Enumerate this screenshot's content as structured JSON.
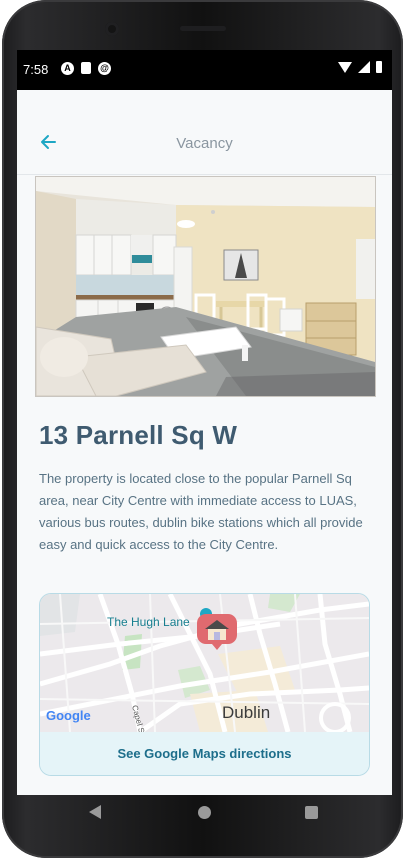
{
  "status_bar": {
    "time": "7:58",
    "icons": [
      "a-circle-icon",
      "sd-card-icon",
      "sync-icon"
    ],
    "right_icons": [
      "wifi-icon",
      "signal-icon",
      "battery-icon"
    ]
  },
  "app_bar": {
    "title": "Vacancy",
    "back_icon": "arrow-left-icon"
  },
  "property": {
    "name": "13 Parnell Sq W",
    "description": "The property is located close to the popular Parnell Sq area, near City Centre with immediate access to LUAS, various bus routes, dublin bike stations which all provide easy and quick access to the City Centre."
  },
  "map": {
    "poi_label": "The Hugh Lane",
    "city_label": "Dublin",
    "street_label": "Capel St",
    "logo": "Google",
    "directions_button": "See Google Maps directions"
  },
  "colors": {
    "accent": "#1ea7c4",
    "title": "#3f5b70",
    "body_text": "#587384",
    "map_button_bg": "#e5f4f8"
  }
}
